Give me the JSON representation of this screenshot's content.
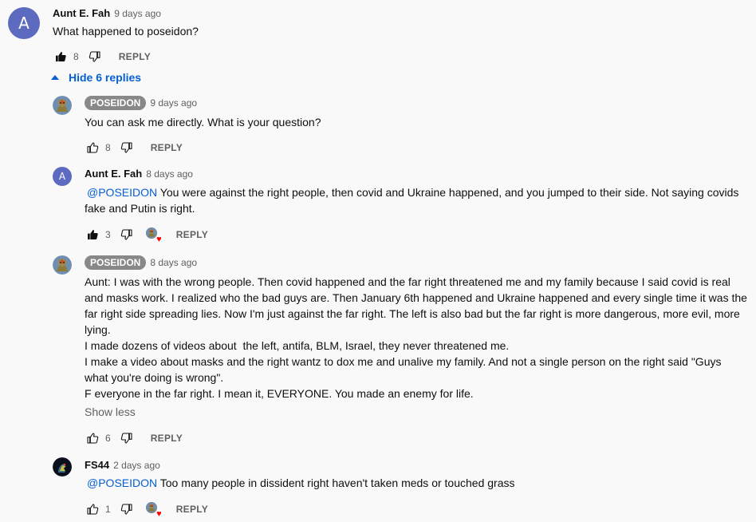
{
  "comment": {
    "avatar_letter": "A",
    "author": "Aunt E. Fah",
    "time": "9 days ago",
    "text": "What happened to poseidon?",
    "likes": "8",
    "reply_label": "REPLY"
  },
  "hide_replies_label": "Hide 6 replies",
  "replies": [
    {
      "author": "POSEIDON",
      "time": "9 days ago",
      "text": "You can ask me directly. What is your question?",
      "likes": "8",
      "reply_label": "REPLY"
    },
    {
      "avatar_letter": "A",
      "author": "Aunt E. Fah",
      "time": "8 days ago",
      "mention": "@POSEIDON",
      "text": " You were against the right people, then covid and Ukraine happened, and you jumped to their side. Not saying covids\nfake and Putin is right.",
      "likes": "3",
      "reply_label": "REPLY",
      "heart": "♥"
    },
    {
      "author": "POSEIDON",
      "time": "8 days ago",
      "text": "Aunt: I was with the wrong people. Then covid happened and the far right threatened me and my family because I said covid is real\nand masks work. I realized who the bad guys are. Then January 6th happened and Ukraine happened and every single time it was the\nfar right side spreading lies. Now I'm just against the far right. The left is also bad but the far right is more dangerous, more evil, more\nlying.\nI made dozens of videos about  the left, antifa, BLM, Israel, they never threatened me.\nI make a video about masks and the right wantz to dox me and unalive my family. And not a single person on the right said \"Guys\nwhat you're doing is wrong\".\nF everyone in the far right. I mean it, EVERYONE. You made an enemy for life.",
      "show_less": "Show less",
      "likes": "6",
      "reply_label": "REPLY"
    },
    {
      "author": "FS44",
      "time": "2 days ago",
      "mention": "@POSEIDON",
      "text": " Too many people in dissident right haven't taken meds or touched grass",
      "likes": "1",
      "reply_label": "REPLY",
      "heart": "♥"
    }
  ],
  "colors": {
    "accent": "#065fd4",
    "avatar_bg": "#5c6bc0",
    "heart": "#ff0000",
    "author_badge": "#888888"
  },
  "icons": {
    "like_filled": "thumbs-up-filled-icon",
    "like_outline": "thumbs-up-outline-icon",
    "dislike": "thumbs-down-outline-icon",
    "collapse": "caret-up-icon"
  }
}
